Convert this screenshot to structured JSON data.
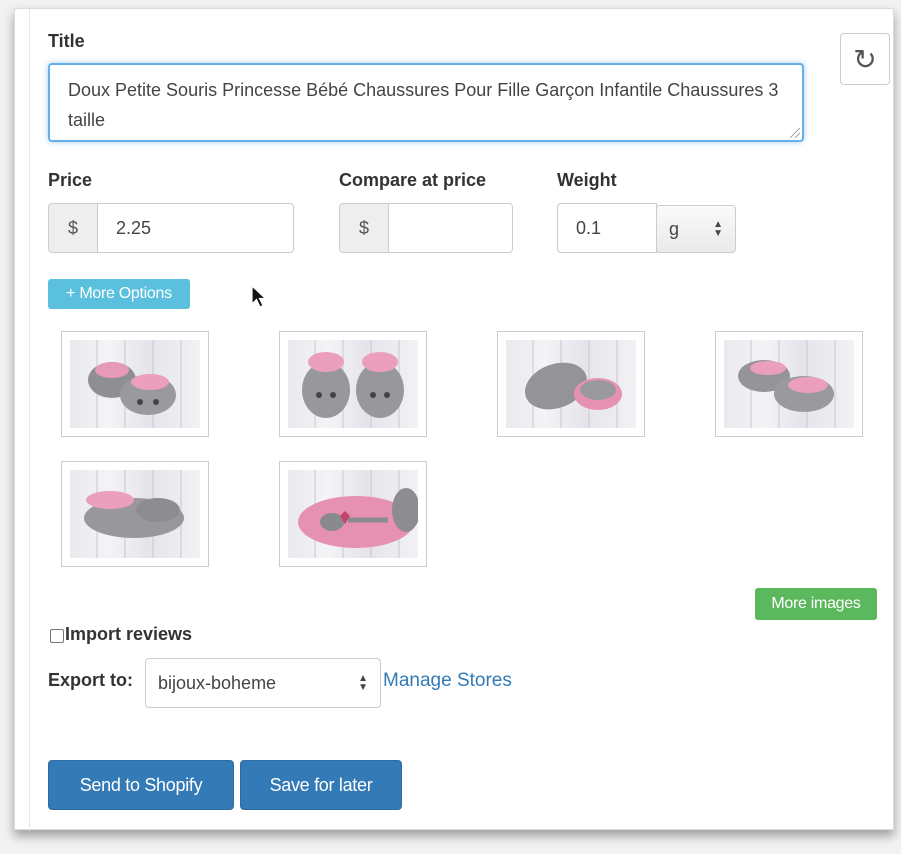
{
  "title_section": {
    "label": "Title",
    "value": "Doux Petite Souris Princesse Bébé Chaussures Pour Fille Garçon Infantile Chaussures 3 taille"
  },
  "pricing": {
    "price_label": "Price",
    "price_currency": "$",
    "price_value": "2.25",
    "compare_label": "Compare at price",
    "compare_currency": "$",
    "compare_value": "",
    "weight_label": "Weight",
    "weight_value": "0.1",
    "weight_unit": "g"
  },
  "buttons": {
    "more_options": "+ More Options",
    "more_images": "More images",
    "send_to_shopify": "Send to Shopify",
    "save_for_later": "Save for later"
  },
  "images": [
    {
      "icon": "baby-shoes-pair-photo"
    },
    {
      "icon": "baby-shoes-front-photo"
    },
    {
      "icon": "baby-shoe-side-photo"
    },
    {
      "icon": "baby-shoes-angle-photo"
    },
    {
      "icon": "baby-shoe-inside-photo"
    },
    {
      "icon": "baby-shoe-sole-photo"
    }
  ],
  "reviews": {
    "label": "Import reviews",
    "checked": false
  },
  "export": {
    "label": "Export to:",
    "selected_store": "bijoux-boheme",
    "manage_link": "Manage Stores"
  },
  "colors": {
    "primary": "#337ab7",
    "info": "#5bc0de",
    "success": "#5cb85c",
    "focus": "#66afe9"
  }
}
